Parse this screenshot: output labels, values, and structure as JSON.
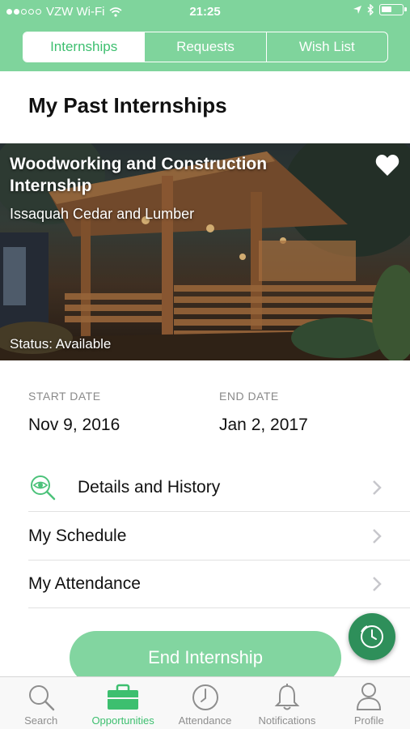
{
  "status_bar": {
    "carrier": "VZW Wi-Fi",
    "time": "21:25",
    "signal_bars": 2
  },
  "segments": [
    {
      "label": "Internships",
      "active": true
    },
    {
      "label": "Requests",
      "active": false
    },
    {
      "label": "Wish List",
      "active": false
    }
  ],
  "page_title": "My Past Internships",
  "internship": {
    "title": "Woodworking and Construction Internship",
    "company": "Issaquah Cedar and Lumber",
    "status": "Status: Available",
    "favorited": true,
    "start_label": "START DATE",
    "start_value": "Nov 9, 2016",
    "end_label": "END DATE",
    "end_value": "Jan 2, 2017"
  },
  "menu": {
    "details": "Details and History",
    "schedule": "My Schedule",
    "attendance": "My Attendance"
  },
  "end_button": "End Internship",
  "tabs": [
    {
      "label": "Search",
      "icon": "search-icon",
      "active": false
    },
    {
      "label": "Opportunities",
      "icon": "briefcase-icon",
      "active": true
    },
    {
      "label": "Attendance",
      "icon": "clock-icon",
      "active": false
    },
    {
      "label": "Notifications",
      "icon": "bell-icon",
      "active": false
    },
    {
      "label": "Profile",
      "icon": "person-icon",
      "active": false
    }
  ],
  "colors": {
    "brand_green": "#7fd49c",
    "active_green": "#3dbf6f",
    "fab_green": "#2e8f5a"
  }
}
